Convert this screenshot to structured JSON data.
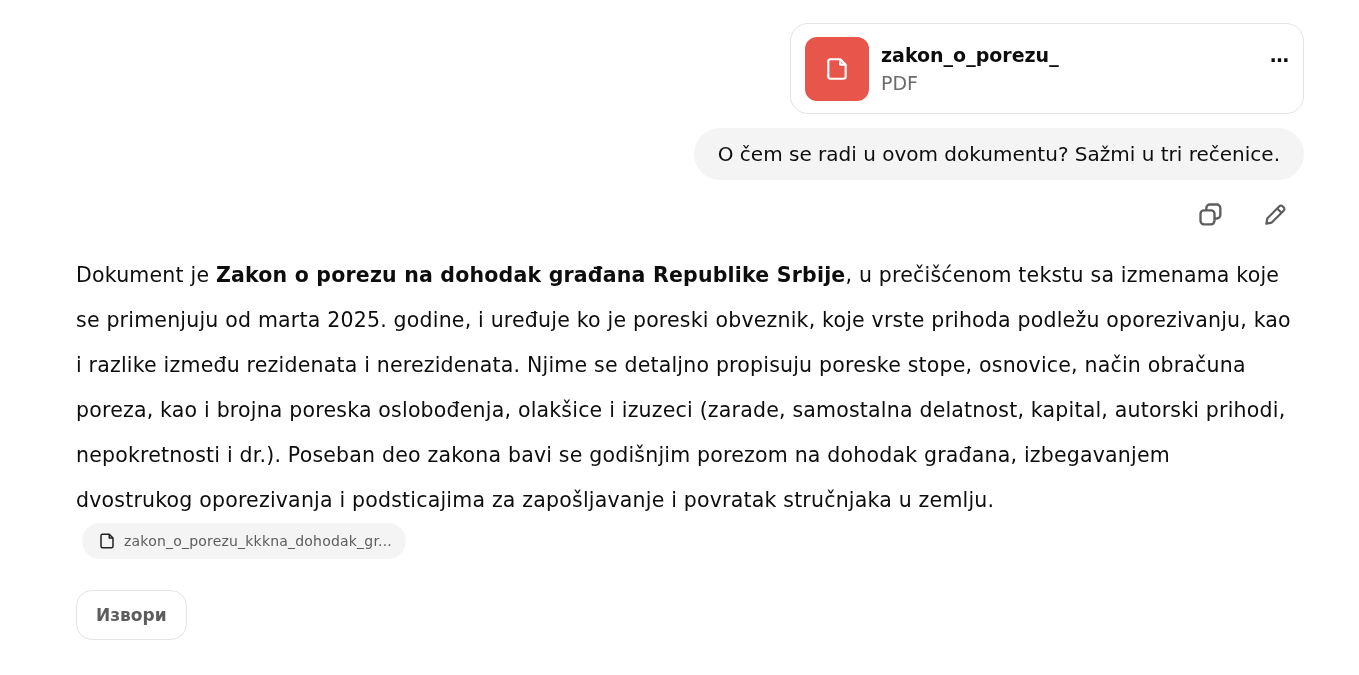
{
  "attachment": {
    "name": "zakon_o_porezu_",
    "ellipsis": "…",
    "type": "PDF"
  },
  "user_message": "O čem se radi u ovom dokumentu? Sažmi u tri rečenice.",
  "assistant_message": {
    "text": "Dokument je **Zakon o porezu na dohodak građana Republike Srbije**, u prečišćenom tekstu sa izmenama koje se primenjuju od marta 2025. godine, i uređuje ko je poreski obveznik, koje vrste prihoda podležu oporezivanju, kao i razlike između rezidenata i nerezidenata. Njime se detaljno propisuju poreske stope, osnovice, način obračuna poreza, kao i brojna poreska oslobođenja, olakšice i izuzeci (zarade, samostalna delatnost, kapital, autorski prihodi, nepokretnosti i dr.). Poseban deo zakona bavi se godišnjim porezom na dohodak građana, izbegavanjem dvostrukog oporezivanja i podsticajima za zapošljavanje i povratak stručnjaka u zemlju.",
    "citation": "zakon_o_porezu_kkkna_dohodak_gr..."
  },
  "sources_button": "Извори"
}
